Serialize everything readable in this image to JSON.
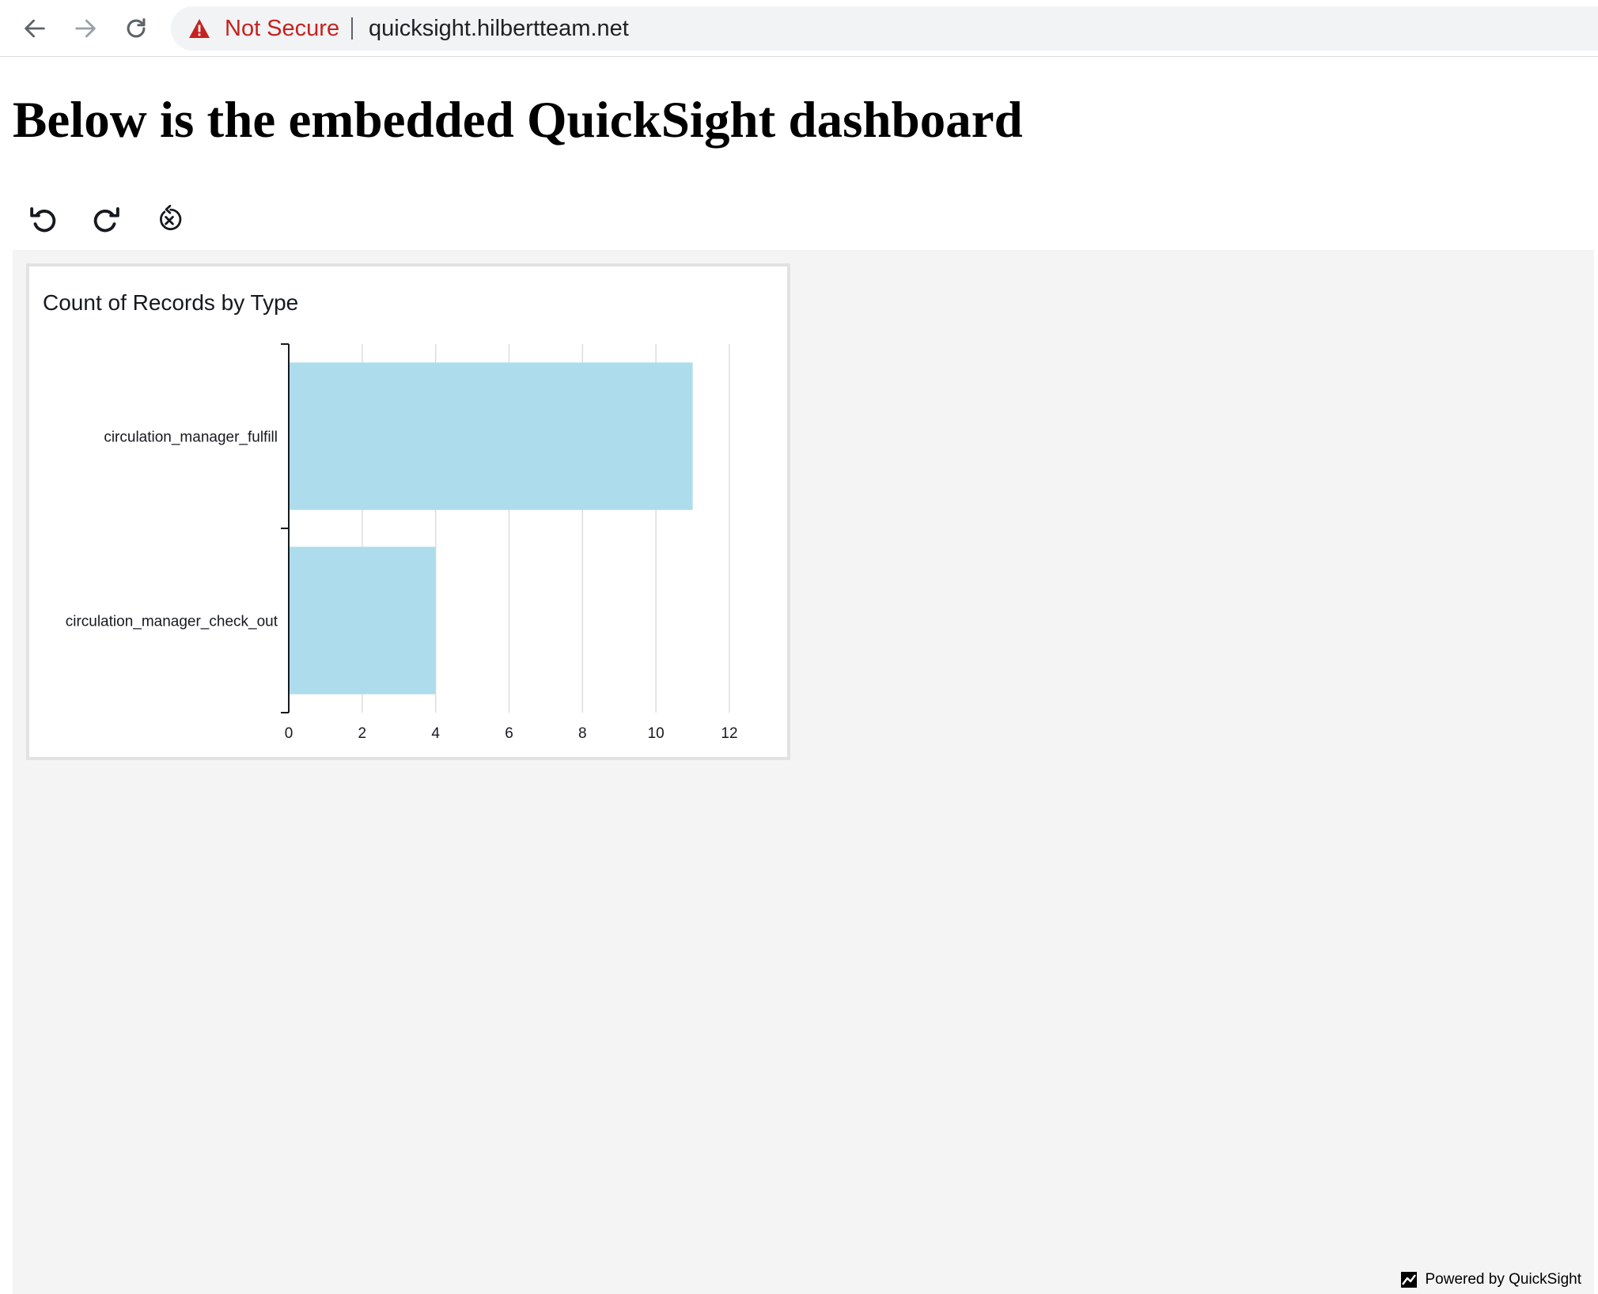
{
  "browser": {
    "security_label": "Not Secure",
    "url": "quicksight.hilbertteam.net",
    "icons": {
      "back": "arrow-left-icon",
      "forward": "arrow-right-icon",
      "reload": "reload-icon",
      "warning": "warning-triangle-icon"
    }
  },
  "page": {
    "heading": "Below is the embedded QuickSight dashboard"
  },
  "toolbar": {
    "icons": [
      "undo-icon",
      "redo-icon",
      "reset-icon"
    ]
  },
  "visual": {
    "title": "Count of Records by Type"
  },
  "chart_data": {
    "type": "bar",
    "orientation": "horizontal",
    "title": "Count of Records by Type",
    "categories": [
      "circulation_manager_fulfill",
      "circulation_manager_check_out"
    ],
    "values": [
      11,
      4
    ],
    "x_ticks": [
      "0",
      "2",
      "4",
      "6",
      "8",
      "10",
      "12"
    ],
    "xlim": [
      0,
      12
    ],
    "grid": true,
    "bar_color": "#addcec",
    "xlabel": "",
    "ylabel": ""
  },
  "footer": {
    "powered_by": "Powered by QuickSight",
    "icon": "quicksight-logo-icon"
  },
  "colors": {
    "warning": "#c5221f",
    "dashboard_background": "#f4f4f4",
    "bar": "#addcec"
  }
}
